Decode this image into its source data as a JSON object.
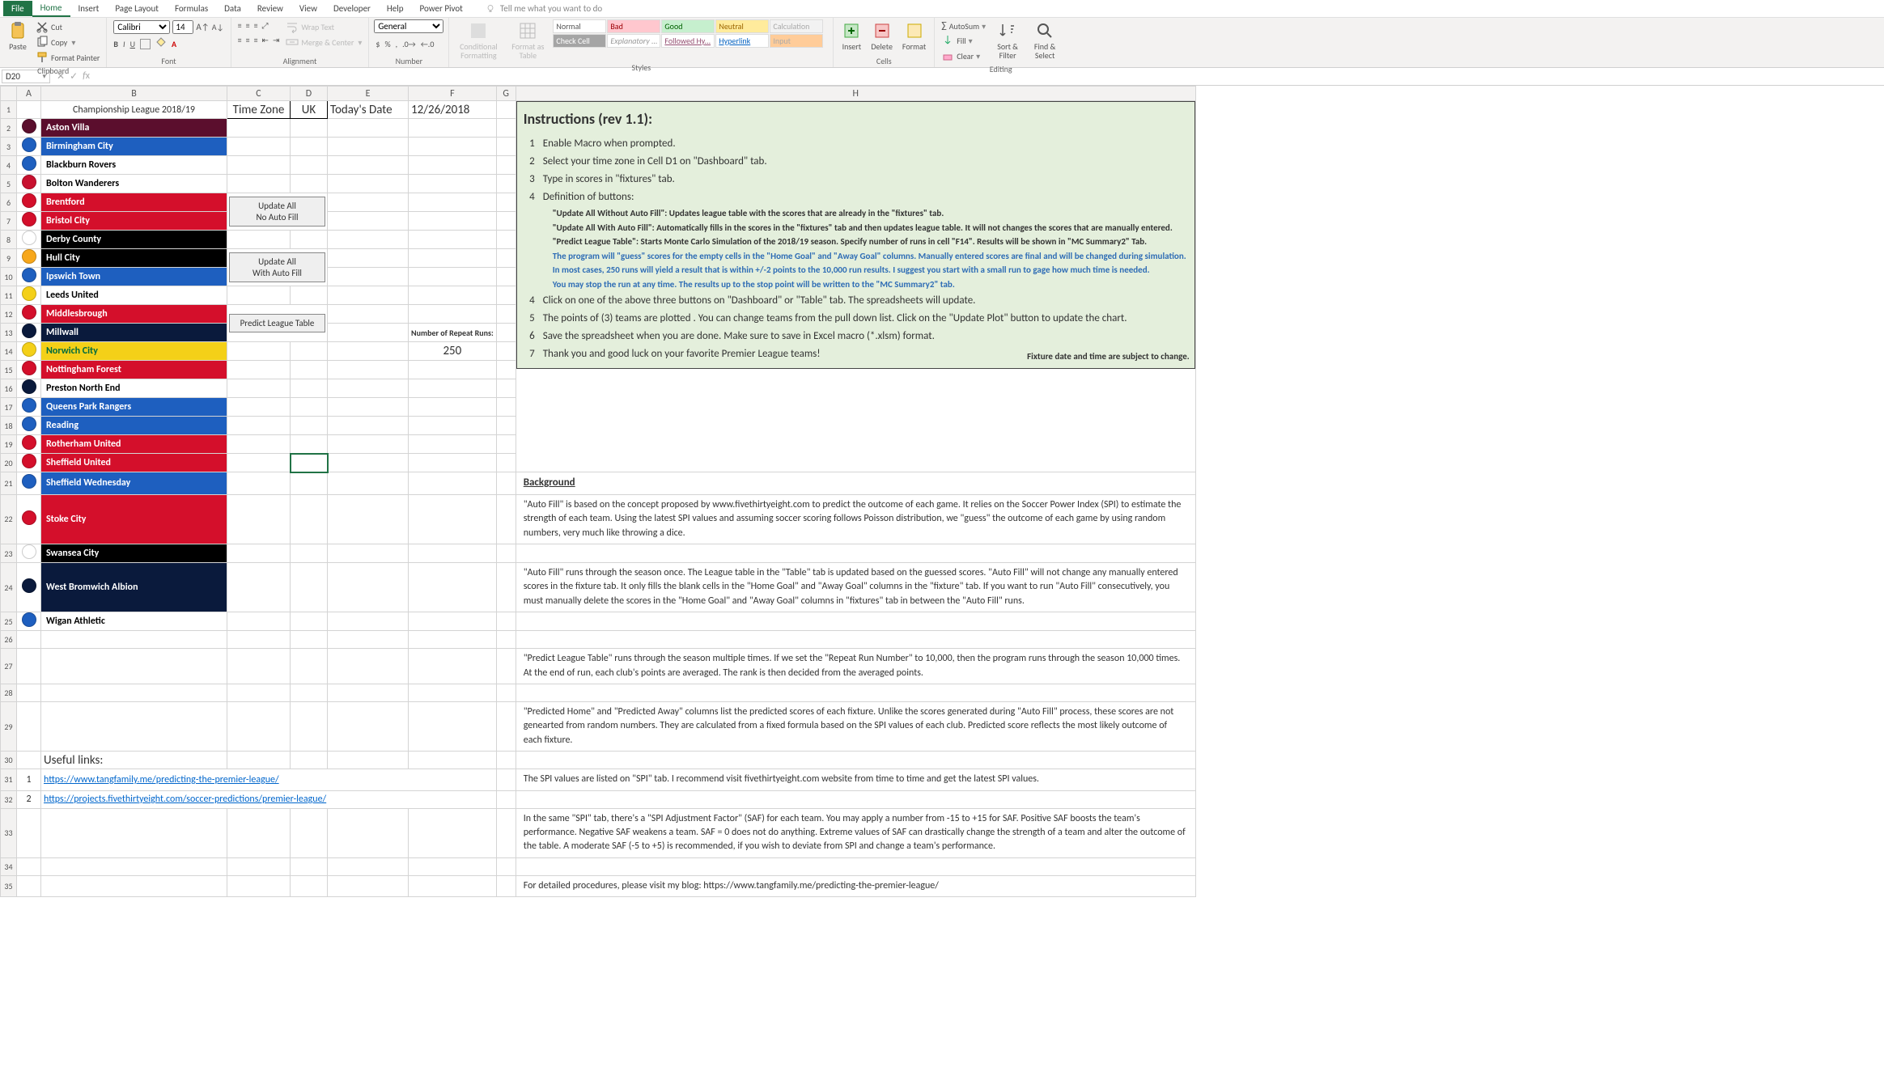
{
  "ribbon_tabs": [
    "File",
    "Home",
    "Insert",
    "Page Layout",
    "Formulas",
    "Data",
    "Review",
    "View",
    "Developer",
    "Help",
    "Power Pivot"
  ],
  "active_tab": "Home",
  "tellme": "Tell me what you want to do",
  "clipboard": {
    "paste": "Paste",
    "cut": "Cut",
    "copy": "Copy",
    "painter": "Format Painter",
    "label": "Clipboard"
  },
  "font": {
    "name": "Calibri",
    "size": "14",
    "label": "Font"
  },
  "alignment": {
    "wrap": "Wrap Text",
    "merge": "Merge & Center",
    "label": "Alignment"
  },
  "number": {
    "format": "General",
    "label": "Number"
  },
  "styles": {
    "cond": "Conditional Formatting",
    "table": "Format as Table",
    "label": "Styles",
    "gallery": [
      "Normal",
      "Bad",
      "Good",
      "Neutral",
      "Calculation",
      "Check Cell",
      "Explanatory ...",
      "Followed Hy...",
      "Hyperlink",
      "Input"
    ]
  },
  "cells": {
    "insert": "Insert",
    "delete": "Delete",
    "format": "Format",
    "label": "Cells"
  },
  "editing": {
    "autosum": "AutoSum",
    "fill": "Fill",
    "clear": "Clear",
    "sort": "Sort & Filter",
    "find": "Find & Select",
    "label": "Editing"
  },
  "namebox": "D20",
  "headers": [
    "A",
    "B",
    "C",
    "D",
    "E",
    "F",
    "G",
    "H"
  ],
  "row1": {
    "title": "Championship League 2018/19",
    "tz_label": "Time Zone",
    "tz_val": "UK",
    "today_label": "Today's Date",
    "today_val": "12/26/2018"
  },
  "teams": [
    {
      "name": "Aston Villa",
      "bg": "#5b0e2d",
      "fg": "#ffffff",
      "badge": "#5b0e2d"
    },
    {
      "name": "Birmingham City",
      "bg": "#1e5fbf",
      "fg": "#ffffff",
      "badge": "#1e5fbf"
    },
    {
      "name": "Blackburn Rovers",
      "bg": "#ffffff",
      "fg": "#000000",
      "badge": "#1e5fbf"
    },
    {
      "name": "Bolton Wanderers",
      "bg": "#ffffff",
      "fg": "#000000",
      "badge": "#c8102e"
    },
    {
      "name": "Brentford",
      "bg": "#d40f2b",
      "fg": "#ffffff",
      "badge": "#d40f2b"
    },
    {
      "name": "Bristol City",
      "bg": "#d40f2b",
      "fg": "#ffffff",
      "badge": "#d40f2b"
    },
    {
      "name": "Derby County",
      "bg": "#000000",
      "fg": "#ffffff",
      "badge": "#ffffff"
    },
    {
      "name": "Hull City",
      "bg": "#000000",
      "fg": "#ffffff",
      "badge": "#f7a71b"
    },
    {
      "name": "Ipswich Town",
      "bg": "#1e5fbf",
      "fg": "#ffffff",
      "badge": "#1e5fbf"
    },
    {
      "name": "Leeds United",
      "bg": "#ffffff",
      "fg": "#000000",
      "badge": "#f4d018"
    },
    {
      "name": "Middlesbrough",
      "bg": "#d40f2b",
      "fg": "#ffffff",
      "badge": "#d40f2b"
    },
    {
      "name": "Millwall",
      "bg": "#0a1a3c",
      "fg": "#ffffff",
      "badge": "#0a1a3c"
    },
    {
      "name": "Norwich City",
      "bg": "#f4d018",
      "fg": "#006b3e",
      "badge": "#f4d018"
    },
    {
      "name": "Nottingham Forest",
      "bg": "#d40f2b",
      "fg": "#ffffff",
      "badge": "#d40f2b"
    },
    {
      "name": "Preston North End",
      "bg": "#ffffff",
      "fg": "#000000",
      "badge": "#0a1a3c"
    },
    {
      "name": "Queens Park Rangers",
      "bg": "#1e5fbf",
      "fg": "#ffffff",
      "badge": "#1e5fbf"
    },
    {
      "name": "Reading",
      "bg": "#1e5fbf",
      "fg": "#ffffff",
      "badge": "#1e5fbf"
    },
    {
      "name": "Rotherham United",
      "bg": "#d40f2b",
      "fg": "#ffffff",
      "badge": "#d40f2b"
    },
    {
      "name": "Sheffield United",
      "bg": "#d40f2b",
      "fg": "#ffffff",
      "badge": "#d40f2b"
    },
    {
      "name": "Sheffield Wednesday",
      "bg": "#1e5fbf",
      "fg": "#ffffff",
      "badge": "#1e5fbf"
    },
    {
      "name": "Stoke City",
      "bg": "#d40f2b",
      "fg": "#ffffff",
      "badge": "#d40f2b"
    },
    {
      "name": "Swansea City",
      "bg": "#000000",
      "fg": "#ffffff",
      "badge": "#ffffff"
    },
    {
      "name": "West Bromwich Albion",
      "bg": "#0a1a3c",
      "fg": "#ffffff",
      "badge": "#0a1a3c"
    },
    {
      "name": "Wigan Athletic",
      "bg": "#ffffff",
      "fg": "#000000",
      "badge": "#1e5fbf"
    }
  ],
  "buttons": {
    "update_no_fill_1": "Update All",
    "update_no_fill_2": "No Auto Fill",
    "update_fill_1": "Update All",
    "update_fill_2": "With Auto Fill",
    "predict": "Predict League Table"
  },
  "repeat_label": "Number of Repeat Runs:",
  "repeat_val": "250",
  "instructions": {
    "title": "Instructions (rev 1.1):",
    "items": [
      "Enable Macro when prompted.",
      "Select your time zone in Cell D1 on \"Dashboard\" tab.",
      "Type in scores in \"fixtures\" tab.",
      "Definition of buttons:"
    ],
    "defs": [
      "\"Update All Without Auto Fill\":  Updates league table with the scores that are already in the \"fixtures\" tab.",
      "\"Update All With Auto Fill\":  Automatically fills in the scores in the \"fixtures\" tab and then updates league table.  It will not changes the scores that are manually entered.",
      "\"Predict League Table\":  Starts Monte Carlo Simulation of the 2018/19 season.  Specify number of runs in cell \"F14\". Results will be shown in \"MC Summary2\" Tab."
    ],
    "notes": [
      "The program will \"guess\"  scores for the empty cells in the \"Home Goal\" and \"Away Goal\" columns.  Manually entered scores are final and will be changed during simulation.",
      "In most cases, 250 runs will yield a result that is within +/-2 points to the 10,000 run results.  I suggest you start with a small run to gage how much time is needed.",
      "You may stop the run at any time.  The results up to the stop point will be written to the \"MC Summary2\" tab."
    ],
    "items2": [
      "Click on one of the above three buttons on \"Dashboard\" or \"Table\" tab.  The spreadsheets will update.",
      "The points of (3) teams are plotted .  You can change teams from the pull down list.  Click on the \"Update Plot\" button to update the chart.",
      "Save the spreadsheet when you are done.  Make sure to save in Excel macro (*.xlsm) format.",
      "Thank you and good luck on your favorite Premier League teams!"
    ],
    "footer": "Fixture date and time are subject to change."
  },
  "useful": "Useful links:",
  "links": [
    "https://www.tangfamily.me/predicting-the-premier-league/",
    "https://projects.fivethirtyeight.com/soccer-predictions/premier-league/"
  ],
  "background": {
    "heading": "Background",
    "paras": [
      "\"Auto Fill\" is based on the concept proposed by www.fivethirtyeight.com to predict the outcome of each game. It relies on the Soccer Power Index (SPI) to estimate the strength of each team.  Using the latest SPI values and assuming soccer scoring follows Poisson distribution, we \"guess\" the outcome of each game by using random numbers, very much like throwing a dice.",
      "\"Auto Fill\" runs through the season once.  The League table in the \"Table\" tab is updated based on the guessed scores.  \"Auto Fill\" will not change any manually entered scores in the fixture tab.  It only fills the blank cells in the \"Home Goal\" and \"Away Goal\" columns in the \"fixture\" tab. If you want to run \"Auto Fill\" consecutively, you must manually delete the scores in the \"Home Goal\" and \"Away Goal\" columns in \"fixtures\" tab in between the \"Auto Fill\" runs.",
      "\"Predict League Table\" runs through the season multiple times.  If we set the \"Repeat Run Number\" to 10,000, then the program runs through the season 10,000 times.  At the end of run, each club's points are averaged.   The rank is then decided from the averaged points.",
      "\"Predicted Home\" and \"Predicted Away\" columns list the predicted scores of each fixture.   Unlike the scores generated during \"Auto Fill\" process, these scores are not genearted from random numbers.  They are calculated from a fixed formula based on the SPI values of each club.  Predicted score reflects the most likely outcome of each fixture.",
      "The SPI values are listed on \"SPI\" tab.  I recommend visit fivethirtyeight.com website from time to time and get the latest SPI values.",
      "In the same \"SPI\" tab, there's a \"SPI Adjustment Factor\" (SAF) for each team.  You may apply a number from -15 to +15 for SAF.  Positive SAF boosts the team's performance.  Negative SAF weakens a team.  SAF = 0 does not do anything.  Extreme values of SAF can drastically change the strength of a team and alter the outcome of the table.  A moderate SAF (-5 to +5) is recommended, if you wish to deviate from SPI and change a team's performance.",
      "For detailed procedures, please visit my blog: https://www.tangfamily.me/predicting-the-premier-league/"
    ]
  }
}
